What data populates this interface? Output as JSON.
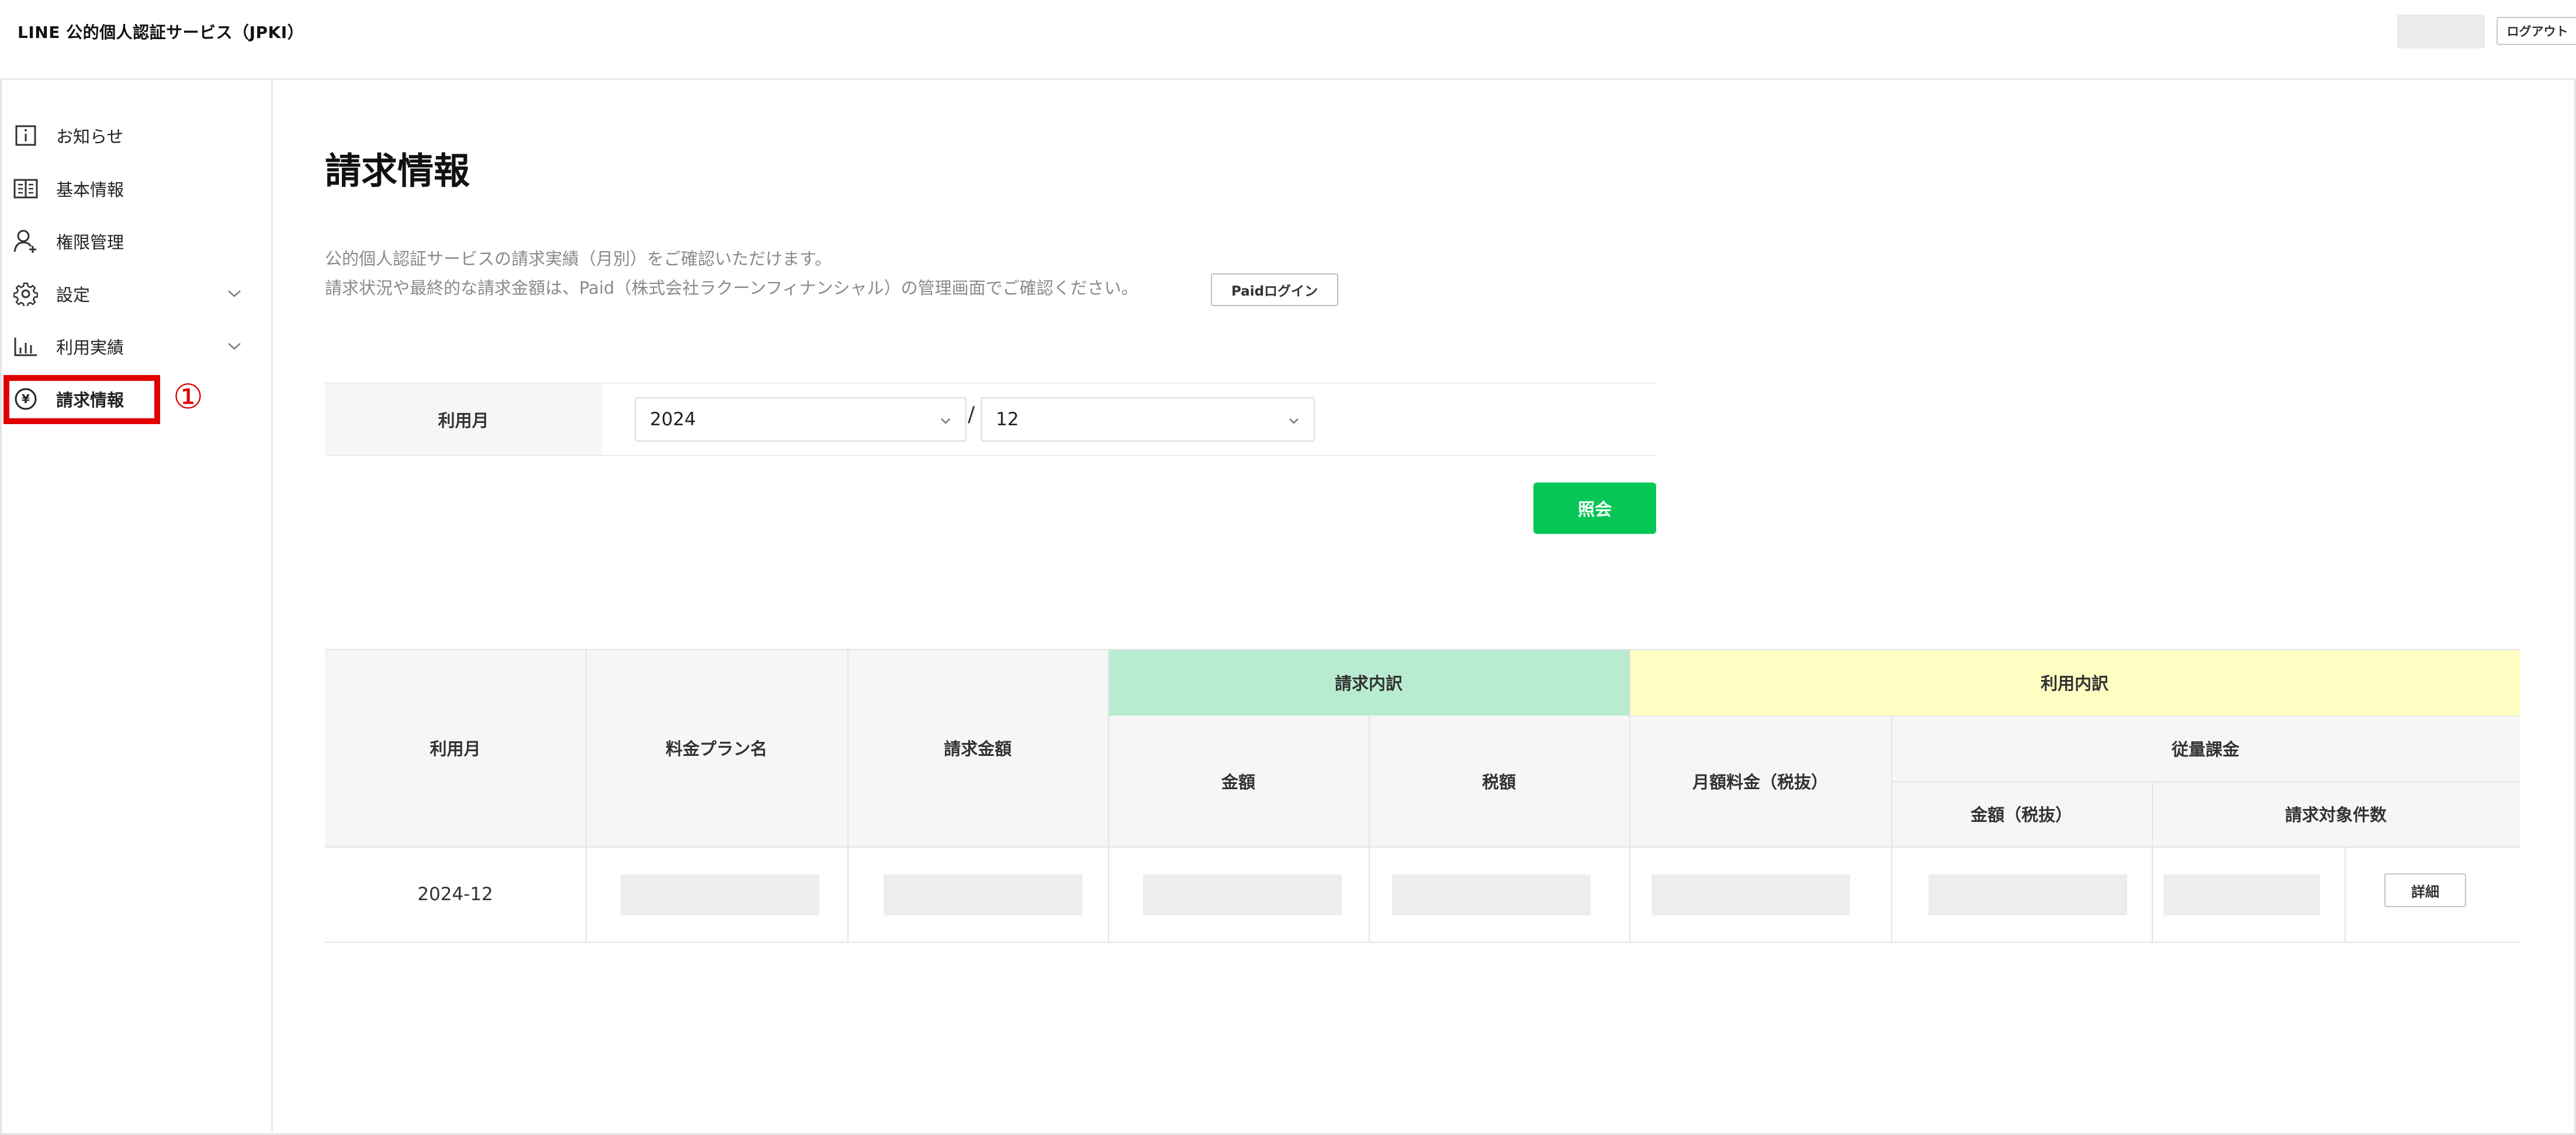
{
  "header": {
    "app_title": "LINE 公的個人認証サービス（JPKI）",
    "logout_label": "ログアウト"
  },
  "sidebar": {
    "items": [
      {
        "label": "お知らせ",
        "icon": "info-icon"
      },
      {
        "label": "基本情報",
        "icon": "book-icon"
      },
      {
        "label": "権限管理",
        "icon": "user-add-icon"
      },
      {
        "label": "設定",
        "icon": "gear-icon"
      },
      {
        "label": "利用実績",
        "icon": "bar-chart-icon"
      },
      {
        "label": "請求情報",
        "icon": "yen-icon",
        "active": true
      }
    ],
    "marker": "①",
    "highlight_color": "#e00000"
  },
  "main": {
    "title": "請求情報",
    "description_1": "公的個人認証サービスの請求実績（月別）をご確認いただけます。",
    "description_2": "請求状況や最終的な請求金額は、Paid（株式会社ラクーンフィナンシャル）の管理画面でご確認ください。",
    "paid_login_label": "Paidログイン",
    "filter": {
      "label": "利用月",
      "year": "2024",
      "separator": "/",
      "month": "12"
    },
    "search_label": "照会",
    "accent_color": "#06c755"
  },
  "table": {
    "headers": {
      "month": "利用月",
      "plan": "料金プラン名",
      "billing_amount": "請求金額",
      "billing_breakdown": "請求内訳",
      "amount": "金額",
      "tax": "税額",
      "usage_breakdown": "利用内訳",
      "monthly_fee": "月額料金（税抜）",
      "metered": "従量課金",
      "metered_amount": "金額（税抜）",
      "billable_count": "請求対象件数"
    },
    "rows": [
      {
        "month": "2024-12",
        "detail_label": "詳細"
      }
    ]
  }
}
